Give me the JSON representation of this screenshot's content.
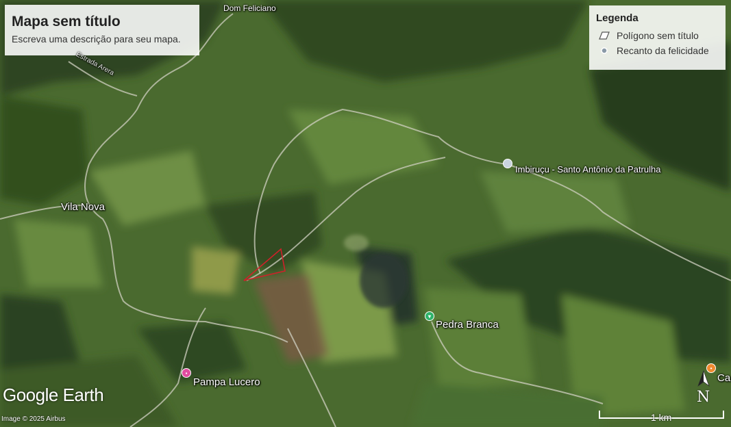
{
  "map": {
    "title": "Mapa sem título",
    "description": "Escreva uma descrição para seu mapa.",
    "legend": {
      "heading": "Legenda",
      "items": [
        {
          "label": "Polígono sem título",
          "icon": "polygon-icon"
        },
        {
          "label": "Recanto da felicidade",
          "icon": "point-icon"
        }
      ]
    },
    "places": {
      "dom_feliciano": "Dom Feliciano",
      "estrada": "Estrada Arera",
      "vila_nova": "Vila Nova",
      "imbirucu": "Imbiruçu - Santo Antônio da Patrulha",
      "pedra_branca": "Pedra Branca",
      "pampa_lucero": "Pampa Lucero",
      "ca": "Ca"
    },
    "logo": "Google Earth",
    "credit": "Image © 2025 Airbus",
    "scale_label": "1 km",
    "compass_label": "N",
    "colors": {
      "polygon_outline": "#d0202a",
      "pedra_branca_pin": "#2fb36a",
      "pampa_lucero_pin": "#e24ca0",
      "ca_pin": "#f08a30",
      "imbirucu_pin": "#c9d3de"
    }
  }
}
